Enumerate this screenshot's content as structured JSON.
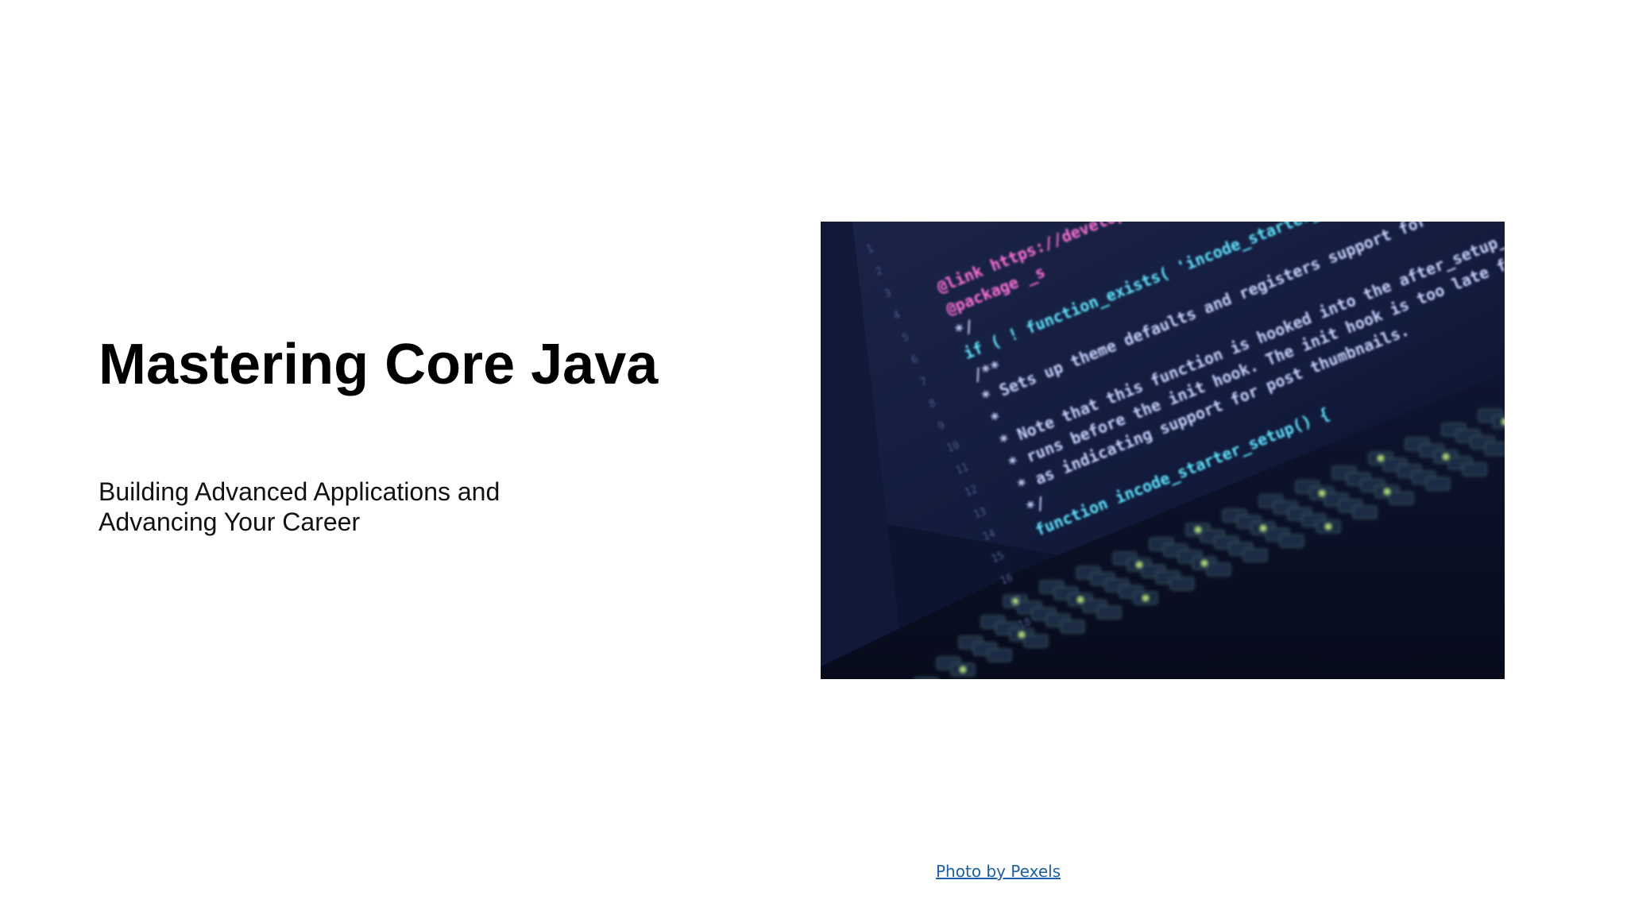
{
  "slide": {
    "title": "Mastering Core Java",
    "subtitle": "Building Advanced Applications and Advancing Your Career",
    "photo_credit": "Photo by Pexels"
  },
  "photo": {
    "code_lines": [
      "@link https://developer",
      "@package _s",
      "*/",
      "if ( ! function_exists( 'incode_starter_setup' ) ) :",
      "/**",
      " * Sets up theme defaults and registers support for various WordPress features.",
      " *",
      " * Note that this function is hooked into the after_setup_theme hook, which",
      " * runs before the init hook. The init hook is too late for some features,",
      " * as indicating support for post thumbnails.",
      " */",
      "function incode_starter_setup() {"
    ],
    "colors": {
      "annotation": "#ff6fd8",
      "function": "#5fe6ff",
      "string": "#e8ff7a",
      "comment": "#c9d2ff",
      "background": "#0c1530"
    }
  }
}
